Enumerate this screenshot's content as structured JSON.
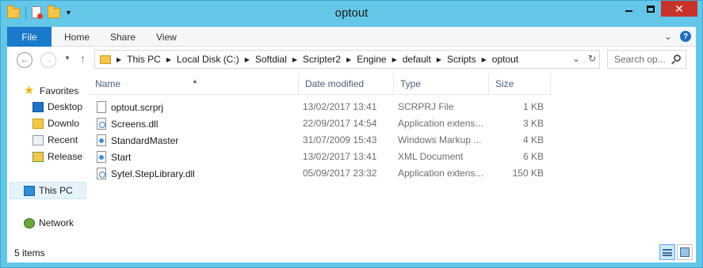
{
  "window": {
    "title": "optout"
  },
  "ribbon": {
    "file_tab": "File",
    "tabs": [
      "Home",
      "Share",
      "View"
    ]
  },
  "address": {
    "crumbs": [
      "This PC",
      "Local Disk (C:)",
      "Softdial",
      "Scripter2",
      "Engine",
      "default",
      "Scripts",
      "optout"
    ]
  },
  "search": {
    "placeholder": "Search op..."
  },
  "nav": {
    "favorites": "Favorites",
    "favorite_items": [
      "Desktop",
      "Downlo",
      "Recent",
      "Release"
    ],
    "this_pc": "This PC",
    "network": "Network"
  },
  "columns": {
    "name": "Name",
    "date": "Date modified",
    "type": "Type",
    "size": "Size"
  },
  "files": [
    {
      "name": "optout.scrprj",
      "date": "13/02/2017 13:41",
      "type": "SCRPRJ File",
      "size": "1 KB",
      "icon": "doc"
    },
    {
      "name": "Screens.dll",
      "date": "22/09/2017 14:54",
      "type": "Application extens...",
      "size": "3 KB",
      "icon": "dll"
    },
    {
      "name": "StandardMaster",
      "date": "31/07/2009 15:43",
      "type": "Windows Markup ...",
      "size": "4 KB",
      "icon": "xml"
    },
    {
      "name": "Start",
      "date": "13/02/2017 13:41",
      "type": "XML Document",
      "size": "6 KB",
      "icon": "xml"
    },
    {
      "name": "Sytel.StepLibrary.dll",
      "date": "05/09/2017 23:32",
      "type": "Application extens...",
      "size": "150 KB",
      "icon": "dll"
    }
  ],
  "status": {
    "item_count": "5 items"
  }
}
